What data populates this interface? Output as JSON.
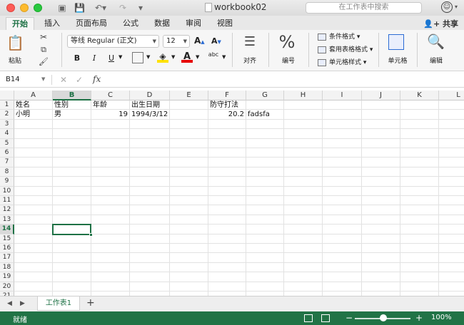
{
  "window": {
    "title": "workbook02",
    "search_placeholder": "在工作表中搜索"
  },
  "tabs": [
    "开始",
    "插入",
    "页面布局",
    "公式",
    "数据",
    "审阅",
    "视图"
  ],
  "active_tab": "开始",
  "share_label": "共享",
  "ribbon": {
    "paste_label": "粘贴",
    "font_name": "等线 Regular (正文)",
    "font_size": "12",
    "grow_font": "A",
    "shrink_font": "A",
    "bold": "B",
    "italic": "I",
    "underline": "U",
    "font_color_letter": "A",
    "abc": "abc",
    "align_label": "对齐",
    "number_symbol": "%",
    "number_label": "编号",
    "cond_format": "条件格式",
    "table_format": "套用表格格式",
    "cell_style": "单元格样式",
    "cells_label": "单元格",
    "edit_label": "编辑"
  },
  "formula_bar": {
    "name_box": "B14",
    "fx": "fx",
    "cancel": "✕",
    "confirm": "✓",
    "formula": ""
  },
  "columns": [
    "A",
    "B",
    "C",
    "D",
    "E",
    "F",
    "G",
    "H",
    "I",
    "J",
    "K",
    "L"
  ],
  "selected_column": "B",
  "rows": [
    "1",
    "2",
    "3",
    "4",
    "5",
    "6",
    "7",
    "8",
    "9",
    "10",
    "11",
    "12",
    "13",
    "14",
    "15",
    "16",
    "17",
    "18",
    "19",
    "20",
    "21"
  ],
  "selected_row": "14",
  "cells": {
    "A1": "姓名",
    "B1": "性别",
    "C1": "年龄",
    "D1": "出生日期",
    "F1": "防守打法",
    "A2": "小明",
    "B2": "男",
    "C2": "19",
    "D2": "1994/3/12",
    "F2": "20.2",
    "G2": "fadsfa"
  },
  "sheet_tabs": [
    "工作表1"
  ],
  "add_sheet": "+",
  "status": {
    "ready": "就绪",
    "zoom": "100%",
    "zoom_minus": "−",
    "zoom_plus": "+"
  },
  "colors": {
    "accent": "#217346",
    "selection": "#1e7145"
  }
}
